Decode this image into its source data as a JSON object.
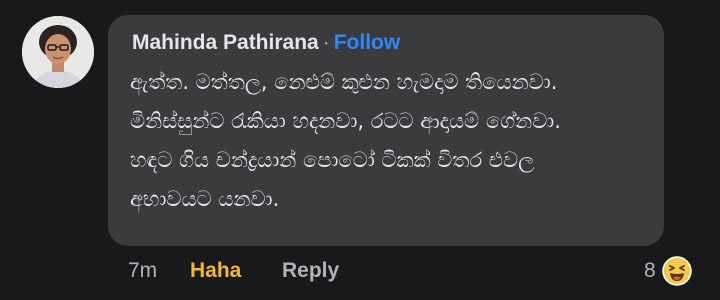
{
  "comment": {
    "author": "Mahinda Pathirana",
    "separator": "·",
    "follow_label": "Follow",
    "lines": [
      "ඇත්ත. මත්තල, නෙළුම් කුළුන හැමදාම තියෙනවා.",
      "මිනිස්සුන්ට රැකියා හදනවා, රටට ආදායම් ගේනවා.",
      "හඳට ගිය චන්ද්‍රයාන් පොටෝ ටිකක් විතර එවල",
      "අභාවයට යනවා."
    ],
    "time": "7m",
    "reaction_label": "Haha",
    "reply_label": "Reply",
    "reaction_count": "8",
    "reaction_icon": "haha-emoji-icon"
  },
  "colors": {
    "background": "#18191a",
    "bubble": "#3a3b3c",
    "text": "#e4e6eb",
    "muted": "#b0b3b8",
    "follow": "#2d88ff",
    "haha": "#f7b928"
  }
}
